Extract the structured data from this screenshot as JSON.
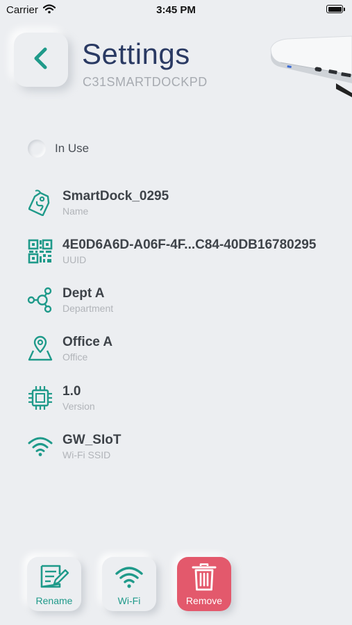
{
  "status_bar": {
    "carrier": "Carrier",
    "time": "3:45 PM"
  },
  "header": {
    "title": "Settings",
    "subtitle": "C31SMARTDOCKPD"
  },
  "in_use": {
    "label": "In Use",
    "checked": false
  },
  "details": [
    {
      "value": "SmartDock_0295",
      "label": "Name",
      "icon": "tag-icon"
    },
    {
      "value": "4E0D6A6D-A06F-4F...C84-40DB16780295",
      "label": "UUID",
      "icon": "qr-code-icon"
    },
    {
      "value": "Dept A",
      "label": "Department",
      "icon": "share-nodes-icon"
    },
    {
      "value": "Office A",
      "label": "Office",
      "icon": "map-location-icon"
    },
    {
      "value": "1.0",
      "label": "Version",
      "icon": "chip-icon"
    },
    {
      "value": "GW_SIoT",
      "label": "Wi-Fi SSID",
      "icon": "wifi-icon"
    }
  ],
  "actions": {
    "rename_label": "Rename",
    "wifi_label": "Wi-Fi",
    "remove_label": "Remove"
  },
  "colors": {
    "accent": "#1f9a8a",
    "title": "#2a3a63",
    "danger": "#e3596c",
    "background": "#eceef1"
  }
}
